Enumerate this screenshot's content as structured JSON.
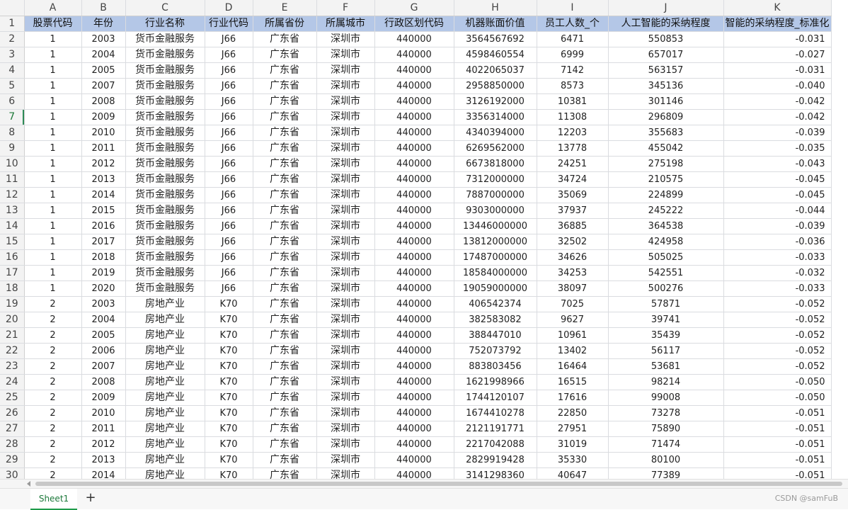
{
  "columns": [
    "A",
    "B",
    "C",
    "D",
    "E",
    "F",
    "G",
    "H",
    "I",
    "J",
    "K"
  ],
  "header": [
    "股票代码",
    "年份",
    "行业名称",
    "行业代码",
    "所属省份",
    "所属城市",
    "行政区划代码",
    "机器账面价值",
    "员工人数_个",
    "人工智能的采纳程度",
    "智能的采纳程度_标准化"
  ],
  "rows": [
    [
      "1",
      "2003",
      "货币金融服务",
      "J66",
      "广东省",
      "深圳市",
      "440000",
      "3564567692",
      "6471",
      "550853",
      "-0.031"
    ],
    [
      "1",
      "2004",
      "货币金融服务",
      "J66",
      "广东省",
      "深圳市",
      "440000",
      "4598460554",
      "6999",
      "657017",
      "-0.027"
    ],
    [
      "1",
      "2005",
      "货币金融服务",
      "J66",
      "广东省",
      "深圳市",
      "440000",
      "4022065037",
      "7142",
      "563157",
      "-0.031"
    ],
    [
      "1",
      "2007",
      "货币金融服务",
      "J66",
      "广东省",
      "深圳市",
      "440000",
      "2958850000",
      "8573",
      "345136",
      "-0.040"
    ],
    [
      "1",
      "2008",
      "货币金融服务",
      "J66",
      "广东省",
      "深圳市",
      "440000",
      "3126192000",
      "10381",
      "301146",
      "-0.042"
    ],
    [
      "1",
      "2009",
      "货币金融服务",
      "J66",
      "广东省",
      "深圳市",
      "440000",
      "3356314000",
      "11308",
      "296809",
      "-0.042"
    ],
    [
      "1",
      "2010",
      "货币金融服务",
      "J66",
      "广东省",
      "深圳市",
      "440000",
      "4340394000",
      "12203",
      "355683",
      "-0.039"
    ],
    [
      "1",
      "2011",
      "货币金融服务",
      "J66",
      "广东省",
      "深圳市",
      "440000",
      "6269562000",
      "13778",
      "455042",
      "-0.035"
    ],
    [
      "1",
      "2012",
      "货币金融服务",
      "J66",
      "广东省",
      "深圳市",
      "440000",
      "6673818000",
      "24251",
      "275198",
      "-0.043"
    ],
    [
      "1",
      "2013",
      "货币金融服务",
      "J66",
      "广东省",
      "深圳市",
      "440000",
      "7312000000",
      "34724",
      "210575",
      "-0.045"
    ],
    [
      "1",
      "2014",
      "货币金融服务",
      "J66",
      "广东省",
      "深圳市",
      "440000",
      "7887000000",
      "35069",
      "224899",
      "-0.045"
    ],
    [
      "1",
      "2015",
      "货币金融服务",
      "J66",
      "广东省",
      "深圳市",
      "440000",
      "9303000000",
      "37937",
      "245222",
      "-0.044"
    ],
    [
      "1",
      "2016",
      "货币金融服务",
      "J66",
      "广东省",
      "深圳市",
      "440000",
      "13446000000",
      "36885",
      "364538",
      "-0.039"
    ],
    [
      "1",
      "2017",
      "货币金融服务",
      "J66",
      "广东省",
      "深圳市",
      "440000",
      "13812000000",
      "32502",
      "424958",
      "-0.036"
    ],
    [
      "1",
      "2018",
      "货币金融服务",
      "J66",
      "广东省",
      "深圳市",
      "440000",
      "17487000000",
      "34626",
      "505025",
      "-0.033"
    ],
    [
      "1",
      "2019",
      "货币金融服务",
      "J66",
      "广东省",
      "深圳市",
      "440000",
      "18584000000",
      "34253",
      "542551",
      "-0.032"
    ],
    [
      "1",
      "2020",
      "货币金融服务",
      "J66",
      "广东省",
      "深圳市",
      "440000",
      "19059000000",
      "38097",
      "500276",
      "-0.033"
    ],
    [
      "2",
      "2003",
      "房地产业",
      "K70",
      "广东省",
      "深圳市",
      "440000",
      "406542374",
      "7025",
      "57871",
      "-0.052"
    ],
    [
      "2",
      "2004",
      "房地产业",
      "K70",
      "广东省",
      "深圳市",
      "440000",
      "382583082",
      "9627",
      "39741",
      "-0.052"
    ],
    [
      "2",
      "2005",
      "房地产业",
      "K70",
      "广东省",
      "深圳市",
      "440000",
      "388447010",
      "10961",
      "35439",
      "-0.052"
    ],
    [
      "2",
      "2006",
      "房地产业",
      "K70",
      "广东省",
      "深圳市",
      "440000",
      "752073792",
      "13402",
      "56117",
      "-0.052"
    ],
    [
      "2",
      "2007",
      "房地产业",
      "K70",
      "广东省",
      "深圳市",
      "440000",
      "883803456",
      "16464",
      "53681",
      "-0.052"
    ],
    [
      "2",
      "2008",
      "房地产业",
      "K70",
      "广东省",
      "深圳市",
      "440000",
      "1621998966",
      "16515",
      "98214",
      "-0.050"
    ],
    [
      "2",
      "2009",
      "房地产业",
      "K70",
      "广东省",
      "深圳市",
      "440000",
      "1744120107",
      "17616",
      "99008",
      "-0.050"
    ],
    [
      "2",
      "2010",
      "房地产业",
      "K70",
      "广东省",
      "深圳市",
      "440000",
      "1674410278",
      "22850",
      "73278",
      "-0.051"
    ],
    [
      "2",
      "2011",
      "房地产业",
      "K70",
      "广东省",
      "深圳市",
      "440000",
      "2121191771",
      "27951",
      "75890",
      "-0.051"
    ],
    [
      "2",
      "2012",
      "房地产业",
      "K70",
      "广东省",
      "深圳市",
      "440000",
      "2217042088",
      "31019",
      "71474",
      "-0.051"
    ],
    [
      "2",
      "2013",
      "房地产业",
      "K70",
      "广东省",
      "深圳市",
      "440000",
      "2829919428",
      "35330",
      "80100",
      "-0.051"
    ],
    [
      "2",
      "2014",
      "房地产业",
      "K70",
      "广东省",
      "深圳市",
      "440000",
      "3141298360",
      "40647",
      "77389",
      "-0.051"
    ]
  ],
  "active_row": 7,
  "sheet_tab": "Sheet1",
  "add_sheet": "+",
  "credit": "CSDN @samFuB",
  "colors": {
    "header_fill": "#b4c7e7",
    "tab_accent": "#1e9b4a",
    "grid_line": "#dadce0"
  }
}
